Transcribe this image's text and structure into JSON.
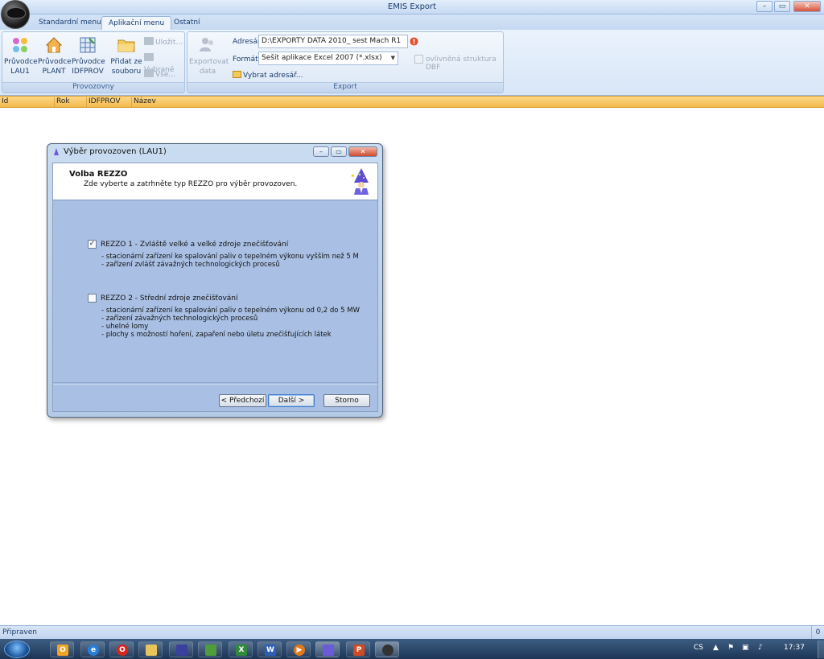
{
  "window": {
    "title": "EMIS Export",
    "minimize": "–",
    "maximize": "▭",
    "close": "✕"
  },
  "tabs": [
    {
      "label": "Standardní menu"
    },
    {
      "label": "Aplikační menu"
    },
    {
      "label": "Ostatní"
    }
  ],
  "ribbon": {
    "provozovny": {
      "group_label": "Provozovny",
      "buttons": [
        {
          "label": "Průvodce LAU1"
        },
        {
          "label": "Průvodce PLANT"
        },
        {
          "label": "Průvodce IDFPROV"
        },
        {
          "label": "Přidat ze souboru"
        }
      ],
      "small": [
        {
          "label": "Uložit..."
        },
        {
          "label": "Vybrané"
        },
        {
          "label": "Vše..."
        }
      ]
    },
    "export": {
      "group_label": "Export",
      "export_button": "Exportovat data",
      "adresar_label": "Adresář",
      "adresar_value": "D:\\EXPORTY DATA 2010_ sest Mach R1",
      "format_label": "Formát",
      "format_value": "Sešit aplikace Excel 2007 (*.xlsx)",
      "vybrat_label": "Vybrat adresář...",
      "dbf_label": "ovlivněná struktura DBF",
      "dbf_checked": false
    }
  },
  "columns": [
    "Id",
    "Rok",
    "IDFPROV",
    "Název"
  ],
  "dialog": {
    "title": "Výběr provozoven (LAU1)",
    "heading": "Volba REZZO",
    "subheading": "Zde vyberte a zatrhněte typ REZZO pro výběr provozoven.",
    "options": [
      {
        "label": "REZZO 1 - Zvláště velké a velké zdroje znečišťování",
        "checked": true,
        "mark": "✓",
        "details": [
          "- stacionární zařízení ke spalování paliv o tepelném výkonu vyšším než 5 M",
          "- zařízení zvlášť závažných technologických procesů"
        ]
      },
      {
        "label": "REZZO 2 - Střední zdroje znečišťování",
        "checked": false,
        "mark": "",
        "details": [
          "- stacionární zařízení ke spalování paliv o tepelném výkonu od 0,2 do 5 MW",
          "- zařízení závažných technologických procesů",
          "- uhelné lomy",
          "- plochy s možností hoření, zapaření nebo úletu znečišťujících látek"
        ]
      }
    ],
    "btn_prev": "< Předchozí",
    "btn_next": "Další >",
    "btn_cancel": "Storno"
  },
  "status": {
    "text": "Připraven",
    "right": "0"
  },
  "taskbar": {
    "lang": "CS",
    "time": "17:37",
    "apps": [
      "outlook-icon",
      "ie-icon",
      "opera-icon",
      "explorer-icon",
      "floppy-icon",
      "book-icon",
      "excel-icon",
      "word-icon",
      "media-icon",
      "wizard-app-icon",
      "powerpoint-icon",
      "emis-icon"
    ]
  },
  "colors": {
    "accent": "#f4b94b",
    "ribbon": "#d8e6f7",
    "dialog_body": "#a9c0e4"
  }
}
